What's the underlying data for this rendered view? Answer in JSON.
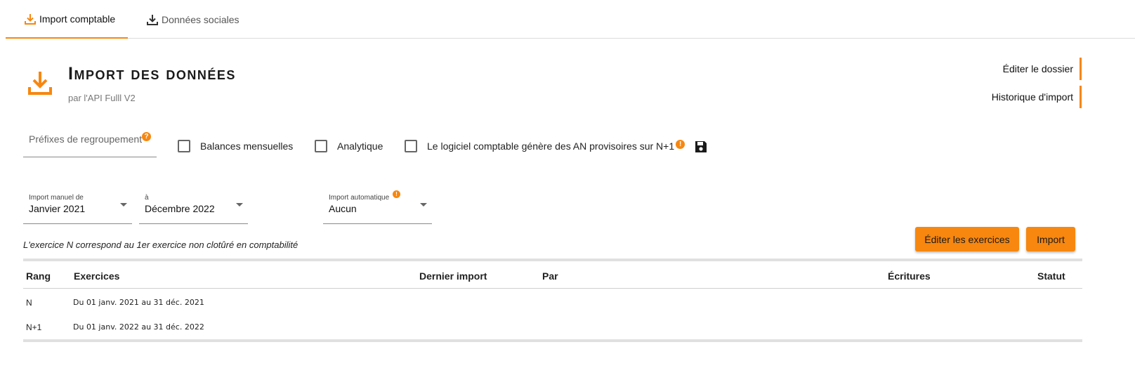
{
  "tabs": [
    {
      "label": "Import comptable",
      "icon": "download-icon",
      "active": true
    },
    {
      "label": "Données sociales",
      "icon": "download-icon",
      "active": false
    }
  ],
  "header": {
    "title": "Import des données",
    "subtitle": "par l'API Fulll V2",
    "icon": "download-icon"
  },
  "side_links": {
    "edit_folder": "Éditer le dossier",
    "import_history": "Historique d'import"
  },
  "options": {
    "prefix_placeholder": "Préfixes de regroupement",
    "monthly_balances": "Balances mensuelles",
    "analytic": "Analytique",
    "provisional_an": "Le logiciel comptable génère des AN provisoires sur N+1"
  },
  "selects": {
    "manual_from": {
      "label": "Import manuel de",
      "value": "Janvier 2021"
    },
    "manual_to": {
      "label": "à",
      "value": "Décembre 2022"
    },
    "auto": {
      "label": "Import automatique",
      "value": "Aucun"
    }
  },
  "note": "L'exercice N correspond au 1er exercice non clotûré en comptabilité",
  "buttons": {
    "edit_exercises": "Éditer les exercices",
    "import": "Import"
  },
  "table": {
    "headers": {
      "rang": "Rang",
      "exercices": "Exercices",
      "dernier_import": "Dernier import",
      "par": "Par",
      "ecritures": "Écritures",
      "statut": "Statut"
    },
    "rows": [
      {
        "rang": "N",
        "exercice": "Du 01 janv. 2021 au 31 déc. 2021"
      },
      {
        "rang": "N+1",
        "exercice": "Du 01 janv. 2022 au 31 déc. 2022"
      }
    ]
  },
  "colors": {
    "accent": "#f7870f",
    "text": "#222222"
  }
}
